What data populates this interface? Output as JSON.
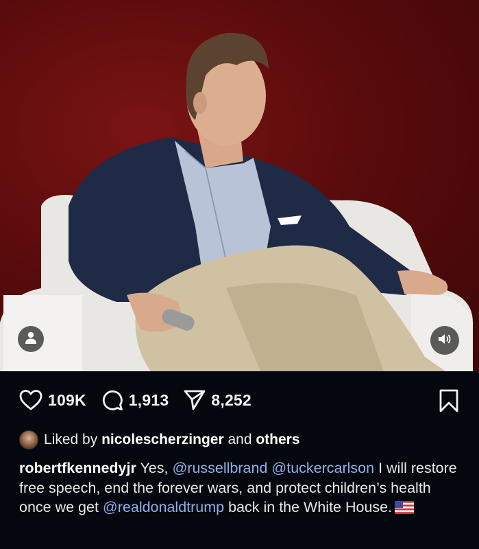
{
  "post": {
    "actions": {
      "likes_count": "109K",
      "comments_count": "1,913",
      "shares_count": "8,252"
    },
    "liked_by": {
      "prefix": "Liked by ",
      "username": "nicolescherzinger",
      "middle": " and ",
      "others": "others"
    },
    "caption": {
      "username": "robertfkennedyjr",
      "text_1": " Yes, ",
      "mention_1": "@russellbrand",
      "space_1": " ",
      "mention_2": "@tuckercarlson",
      "text_2": " I will restore free speech, end the forever wars, and protect children’s health once we get ",
      "mention_3": "@realdonaldtrump",
      "text_3": " back in the White House."
    },
    "icons": {
      "like": "heart-icon",
      "comment": "comment-icon",
      "share": "send-icon",
      "save": "bookmark-icon",
      "tag": "person-icon",
      "sound": "speaker-icon",
      "flag": "us-flag-icon"
    },
    "colors": {
      "background": "#05070f",
      "mention": "#8fb0e8",
      "media_backdrop": "#5a0b0c"
    }
  }
}
